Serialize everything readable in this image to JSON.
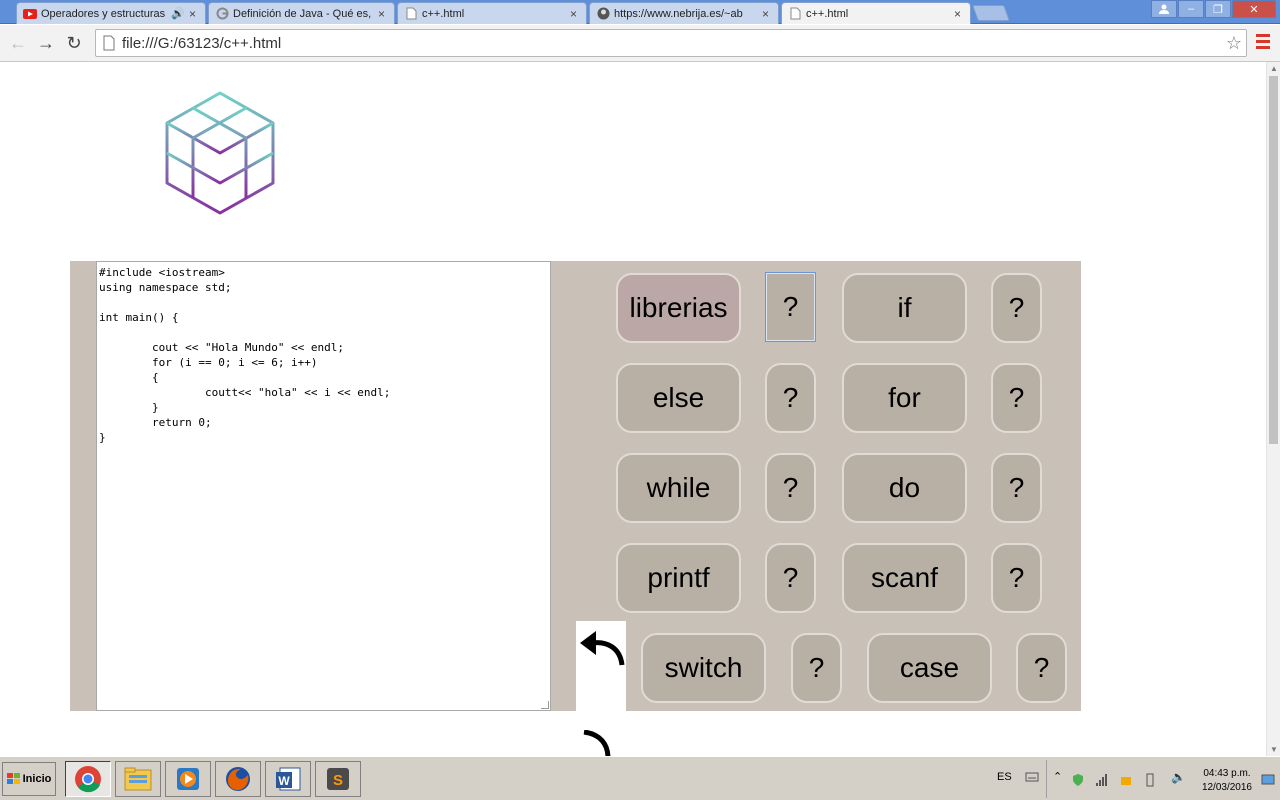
{
  "browser": {
    "tabs": [
      {
        "label": "Operadores y estructuras",
        "icon": "youtube-icon",
        "active": false
      },
      {
        "label": "Definición de Java - Qué es,",
        "icon": "google-icon",
        "active": false
      },
      {
        "label": "c++.html",
        "icon": "page-icon",
        "active": false
      },
      {
        "label": "https://www.nebrija.es/~ab",
        "icon": "user-avatar-icon",
        "active": false
      },
      {
        "label": "c++.html",
        "icon": "page-icon",
        "active": true
      }
    ],
    "url": "file:///G:/63123/c++.html"
  },
  "page": {
    "code": "#include <iostream>\nusing namespace std;\n\nint main() {\n\n\tcout << \"Hola Mundo\" << endl;\n\tfor (i == 0; i <= 6; i++)\n\t{\n\t\tcoutt<< \"hola\" << i << endl;\n\t}\n\treturn 0;\n}",
    "keywords": {
      "row1": [
        "librerias",
        "if"
      ],
      "row2": [
        "else",
        "for"
      ],
      "row3": [
        "while",
        "do"
      ],
      "row4": [
        "printf",
        "scanf"
      ],
      "row5": [
        "switch",
        "case"
      ]
    },
    "help_label": "?"
  },
  "taskbar": {
    "start_label": "Inicio",
    "apps": [
      "chrome-icon",
      "file-explorer-icon",
      "media-player-icon",
      "firefox-icon",
      "word-icon",
      "sublime-text-icon"
    ],
    "language": "ES",
    "time": "04:43 p.m.",
    "date": "12/03/2016"
  },
  "colors": {
    "panel_bg": "#c9c1b8",
    "button_bg": "#b9b0a5",
    "button_active_bg": "#bba8a6",
    "logo_top": "#6fd3c5",
    "logo_bottom": "#8a2ea0"
  }
}
